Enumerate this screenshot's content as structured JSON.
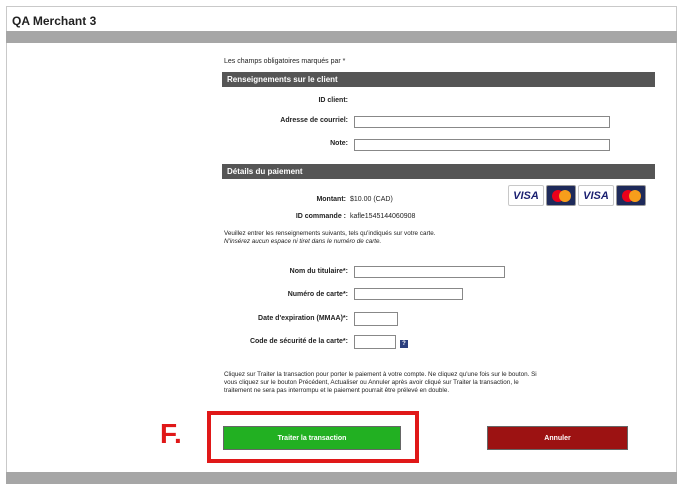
{
  "merchant": {
    "title": "QA Merchant 3"
  },
  "form": {
    "required_note": "Les champs obligatoires marqués par *",
    "client_section": {
      "header": "Renseignements sur le client",
      "client_id_label": "ID client:",
      "email_label": "Adresse de courriel:",
      "email_value": "",
      "note_label": "Note:",
      "note_value": ""
    },
    "payment_section": {
      "header": "Détails du paiement",
      "amount_label": "Montant:",
      "amount_value": "$10.00 (CAD)",
      "order_label": "ID commande :",
      "order_value": "kafle1545144060908",
      "card_logos": [
        "VISA",
        "MasterCard",
        "VISA Debit",
        "Debit MasterCard"
      ],
      "instructions_line1": "Veuillez entrer les renseignements suivants, tels qu'indiqués sur votre carte.",
      "instructions_line2": "N'insérez aucun espace ni tiret dans le numéro de carte.",
      "holder_label": "Nom du titulaire*:",
      "holder_value": "",
      "card_number_label": "Numéro de carte*:",
      "card_number_value": "",
      "expiry_label": "Date d'expiration (MMAA)*:",
      "expiry_value": "",
      "cvv_label": "Code de sécurité de la carte*:",
      "cvv_value": "",
      "help_icon": "?"
    },
    "notice_line1": "Cliquez sur Traiter la transaction pour porter le paiement à votre compte. Ne cliquez qu'une fois sur le bouton. Si",
    "notice_line2": "vous cliquez sur le bouton Précédent, Actualiser ou Annuler après avoir cliqué sur Traiter la transaction, le",
    "notice_line3": "traitement ne sera pas interrompu et le paiement pourrait être prélevé en double.",
    "submit_label": "Traiter la transaction",
    "cancel_label": "Annuler"
  },
  "annotation": {
    "marker": "F.",
    "color": "#e01818"
  },
  "colors": {
    "section_header": "#555555",
    "submit_button": "#22b022",
    "cancel_button": "#9c1212",
    "top_bar": "#a6a6a6"
  }
}
